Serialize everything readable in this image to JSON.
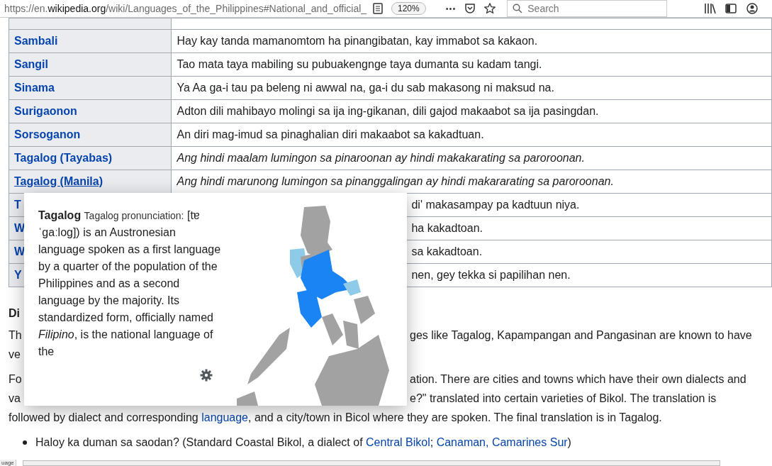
{
  "toolbar": {
    "url_prefix": "https://en.",
    "url_domain": "wikipedia.org",
    "url_path": "/wiki/Languages_of_the_Philippines#National_and_official_",
    "zoom": "120%",
    "dots": "•••",
    "search": {
      "placeholder": "Search"
    }
  },
  "table": {
    "rows": [
      {
        "name": "Sambali",
        "text": "Hay kay tanda mamanomtom ha pinangibatan, kay immabot sa kakaon.",
        "italic": false,
        "hovered": false,
        "kind": "full"
      },
      {
        "name": "Sangil",
        "text": "Tao mata taya mabiling su pubuakengnge taya dumanta su kadam tangi.",
        "italic": false,
        "hovered": false,
        "kind": "full"
      },
      {
        "name": "Sinama",
        "text": "Ya Aa ga-i tau pa beleng ni awwal na, ga-i du sab makasong ni maksud na.",
        "italic": false,
        "hovered": false,
        "kind": "full"
      },
      {
        "name": "Surigaonon",
        "text": "Adton dili mahibayo molingi sa ija ing-gikanan, dili gajod makaabot sa ija pasingdan.",
        "italic": false,
        "hovered": false,
        "kind": "full"
      },
      {
        "name": "Sorsoganon",
        "text": "An diri mag-imud sa pinaghalian diri makaabot sa kakadtuan.",
        "italic": false,
        "hovered": false,
        "kind": "full"
      },
      {
        "name": "Tagalog (Tayabas)",
        "text": "Ang hindi maalam lumingon sa pinaroonan ay hindi makakarating sa paroroonan.",
        "italic": true,
        "hovered": false,
        "kind": "full"
      },
      {
        "name": "Tagalog (Manila)",
        "text": "Ang hindi marunong lumingon sa pinanggalingan ay hindi makararating sa paroroonan.",
        "italic": true,
        "hovered": true,
        "kind": "full"
      },
      {
        "name": "T",
        "text": "di' makasampay pa kadtuun niya.",
        "italic": false,
        "hovered": false,
        "kind": "covered"
      },
      {
        "name": "W",
        "text": "ha kakadtoan.",
        "italic": false,
        "hovered": false,
        "kind": "covered"
      },
      {
        "name": "W",
        "text": "sa kakadtoan.",
        "italic": false,
        "hovered": false,
        "kind": "covered"
      },
      {
        "name": "Y",
        "text": "nen, gey tekka si papilihan nen.",
        "italic": false,
        "hovered": false,
        "kind": "covered"
      }
    ]
  },
  "section": {
    "heading": "Di",
    "lines": [
      {
        "left": "Th",
        "right": "ges like Tagalog, Kapampangan and Pangasinan are known to have"
      },
      {
        "left": "ve"
      },
      {
        "left": "Fo",
        "right": "ation. There are cities and towns which have their own dialects and"
      },
      {
        "left": "va",
        "right": "e?\" translated into certain varieties of Bikol. The translation is"
      }
    ],
    "paragraph": [
      {
        "text": "followed by dialect and corresponding ",
        "link": false
      },
      {
        "text": "language",
        "link": true
      },
      {
        "text": ", and a city/town in Bicol where they are spoken. The final translation is in Tagalog.",
        "link": false
      }
    ],
    "bullets": [
      [
        {
          "text": "Haloy ka duman sa saodan? (Standard Coastal Bikol, a dialect of ",
          "link": false
        },
        {
          "text": "Central Bikol",
          "link": true
        },
        {
          "text": "; ",
          "link": false
        },
        {
          "text": "Canaman, Camarines Sur",
          "link": true
        },
        {
          "text": ")",
          "link": false
        }
      ]
    ]
  },
  "popup": {
    "title": "Tagalog",
    "pronunciation_label": "Tagalog pronunciation:",
    "extract": "[tɐˈɡaːloɡ]) is an Austronesian language spoken as a first language by a quarter of the population of the Philippines and as a second language by the majority. Its standardized form, officially named *Filipino*, is the national language of the"
  },
  "status": {
    "link_text": "uage"
  }
}
